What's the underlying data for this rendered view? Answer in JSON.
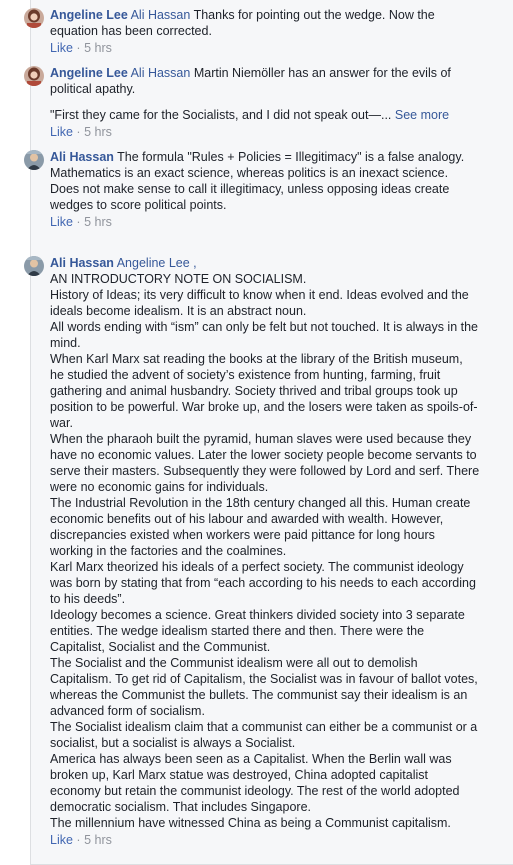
{
  "comments": [
    {
      "author": "Angeline Lee",
      "mention": "Ali Hassan",
      "lines": [
        "Thanks for pointing out the wedge. Now the equation has been corrected."
      ],
      "like": "Like",
      "sep": "·",
      "time": "5 hrs"
    },
    {
      "author": "Angeline Lee",
      "mention": "Ali Hassan",
      "lines": [
        "Martin Niemöller has an answer for the evils of political apathy."
      ],
      "quote": "\"First they came for the Socialists, and I did not speak out—...",
      "see_more": "See more",
      "like": "Like",
      "sep": "·",
      "time": "5 hrs"
    },
    {
      "author": "Ali Hassan",
      "lines": [
        "The formula \"Rules + Policies = Illegitimacy\" is a false analogy.",
        "Mathematics is an exact science, whereas politics is an inexact science. Does not make sense to call it illegitimacy, unless opposing ideas create wedges to score political points."
      ],
      "like": "Like",
      "sep": "·",
      "time": "5 hrs"
    },
    {
      "author": "Ali Hassan",
      "mention": "Angeline Lee ,",
      "lines": [
        "AN INTRODUCTORY NOTE ON SOCIALISM.",
        "History of Ideas; its very difficult to know when it end. Ideas evolved and the ideals become idealism. It is an abstract noun.",
        "All words ending with “ism” can only be felt but not touched. It is always in the mind.",
        "When Karl Marx sat reading the books at the library of the British museum, he studied the advent of society’s existence from hunting, farming, fruit gathering and animal husbandry. Society thrived and tribal groups took up position to be powerful. War broke up, and the losers were taken as spoils-of-war.",
        "When the pharaoh built the pyramid, human slaves were used because they have no economic values. Later the lower society people become servants to serve their masters. Subsequently they were followed by Lord and serf. There were no economic gains for individuals.",
        "The Industrial Revolution in the 18th century changed all this. Human create economic benefits out of his labour and awarded with wealth. However, discrepancies existed when workers were paid pittance for long hours working in the factories and the coalmines.",
        "Karl Marx theorized his ideals of a perfect society. The communist ideology was born by stating that from “each according to his needs to each according to his deeds”.",
        "Ideology becomes a science. Great thinkers divided society into 3 separate entities. The wedge idealism started there and then. There were the Capitalist, Socialist and the Communist.",
        "The Socialist and the Communist idealism were all out to demolish Capitalism. To get rid of Capitalism, the Socialist was in favour of ballot votes, whereas the Communist the bullets. The communist say their idealism is an advanced form of socialism.",
        "The Socialist idealism claim that a communist can either be a communist or a socialist, but a socialist is always a Socialist.",
        "America has always been seen as a Capitalist. When the Berlin wall was broken up, Karl Marx statue was destroyed, China adopted capitalist economy but retain the communist ideology. The rest of the world adopted democratic socialism. That includes Singapore.",
        "The millennium have witnessed China as being a Communist capitalism."
      ],
      "like": "Like",
      "sep": "·",
      "time": "5 hrs"
    }
  ]
}
